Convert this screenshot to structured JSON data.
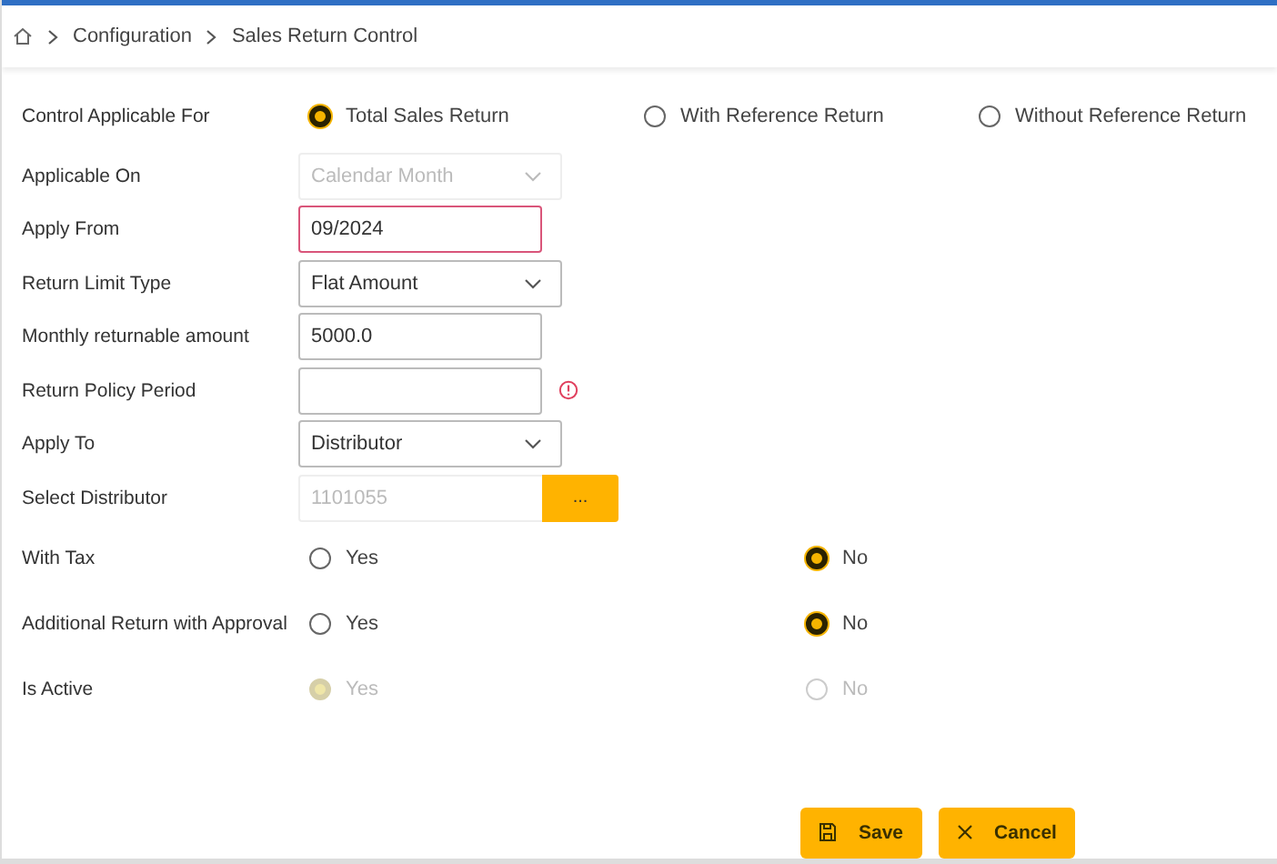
{
  "breadcrumb": [
    {
      "label": "Configuration"
    },
    {
      "label": "Sales Return Control"
    }
  ],
  "control_applicable": {
    "label": "Control Applicable For",
    "options": [
      {
        "label": "Total Sales Return",
        "selected": true
      },
      {
        "label": "With Reference Return",
        "selected": false
      },
      {
        "label": "Without Reference Return",
        "selected": false
      }
    ]
  },
  "fields": [
    {
      "label": "Applicable On",
      "kind": "select",
      "value": "Calendar Month",
      "disabled": true
    },
    {
      "label": "Apply From",
      "kind": "input",
      "value": "09/2024",
      "disabled": false,
      "invalid": true
    },
    {
      "label": "Return Limit Type",
      "kind": "select",
      "value": "Flat Amount",
      "disabled": false
    },
    {
      "label": "Monthly returnable amount",
      "kind": "input",
      "value": "5000.0",
      "disabled": false
    },
    {
      "label": "Return Policy Period",
      "kind": "input",
      "disabled": false,
      "error": true
    },
    {
      "label": "Apply To",
      "kind": "select",
      "value": "Distributor",
      "disabled": false
    },
    {
      "label": "Select Distributor",
      "kind": "lookup",
      "value": "1101055",
      "button": "...",
      "disabled": true
    }
  ],
  "radio_rows": [
    {
      "label": "With Tax",
      "disabled": false,
      "options": [
        {
          "label": "Yes",
          "selected": false
        },
        {
          "label": "No",
          "selected": true
        }
      ]
    },
    {
      "label": "Additional Return with Approval",
      "disabled": false,
      "options": [
        {
          "label": "Yes",
          "selected": false
        },
        {
          "label": "No",
          "selected": true
        }
      ]
    },
    {
      "label": "Is Active",
      "disabled": true,
      "options": [
        {
          "label": "Yes",
          "selected": true
        },
        {
          "label": "No",
          "selected": false
        }
      ]
    }
  ],
  "buttons": [
    {
      "label": "Save",
      "kind": "save"
    },
    {
      "label": "Cancel",
      "kind": "cancel"
    }
  ]
}
